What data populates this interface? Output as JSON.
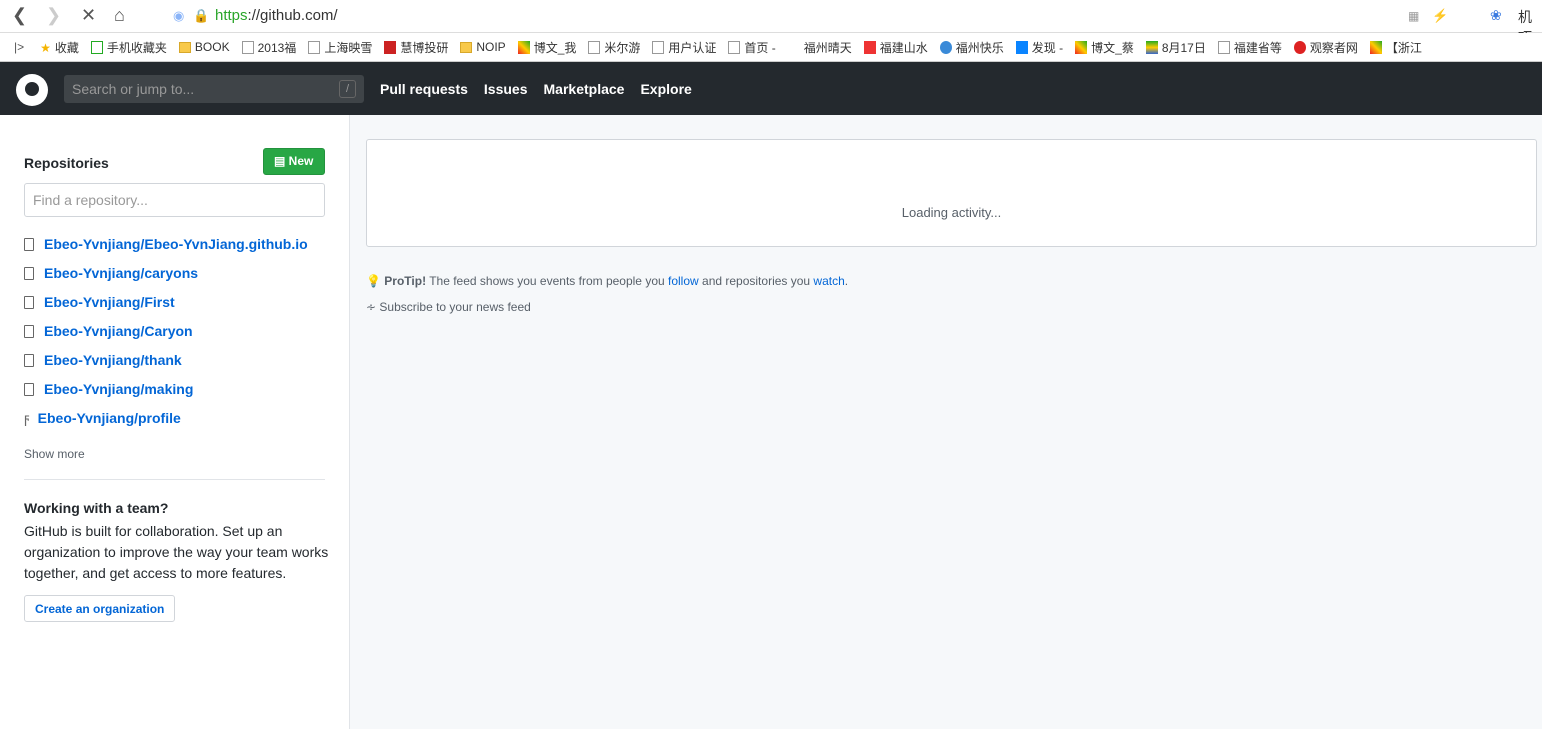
{
  "browser": {
    "url_scheme": "https",
    "url_rest": "://github.com/",
    "profile": "机巧"
  },
  "bookmarks": [
    "收藏",
    "手机收藏夹",
    "BOOK",
    "2013福",
    "上海映雪",
    "慧博投研",
    "NOIP",
    "博文_我",
    "米尔游",
    "用户认证",
    "首页 -",
    "福州晴天",
    "福建山水",
    "福州快乐",
    "发现 -",
    "博文_蔡",
    "8月17日",
    "福建省等",
    "观察者网",
    "【浙江"
  ],
  "header": {
    "search_placeholder": "Search or jump to...",
    "slash": "/",
    "nav": [
      "Pull requests",
      "Issues",
      "Marketplace",
      "Explore"
    ]
  },
  "sidebar": {
    "title": "Repositories",
    "new_label": "New",
    "find_placeholder": "Find a repository...",
    "repos": [
      "Ebeo-Yvnjiang/Ebeo-YvnJiang.github.io",
      "Ebeo-Yvnjiang/caryons",
      "Ebeo-Yvnjiang/First",
      "Ebeo-Yvnjiang/Caryon",
      "Ebeo-Yvnjiang/thank",
      "Ebeo-Yvnjiang/making",
      "Ebeo-Yvnjiang/profile"
    ],
    "show_more": "Show more",
    "team_title": "Working with a team?",
    "team_text": "GitHub is built for collaboration. Set up an organization to improve the way your team works together, and get access to more features.",
    "create_org": "Create an organization"
  },
  "main": {
    "loading": "Loading activity...",
    "protip_label": "ProTip!",
    "protip_text1": " The feed shows you events from people you ",
    "follow": "follow",
    "protip_text2": " and repositories you ",
    "watch": "watch",
    "protip_end": ".",
    "subscribe": "Subscribe to your news feed"
  }
}
